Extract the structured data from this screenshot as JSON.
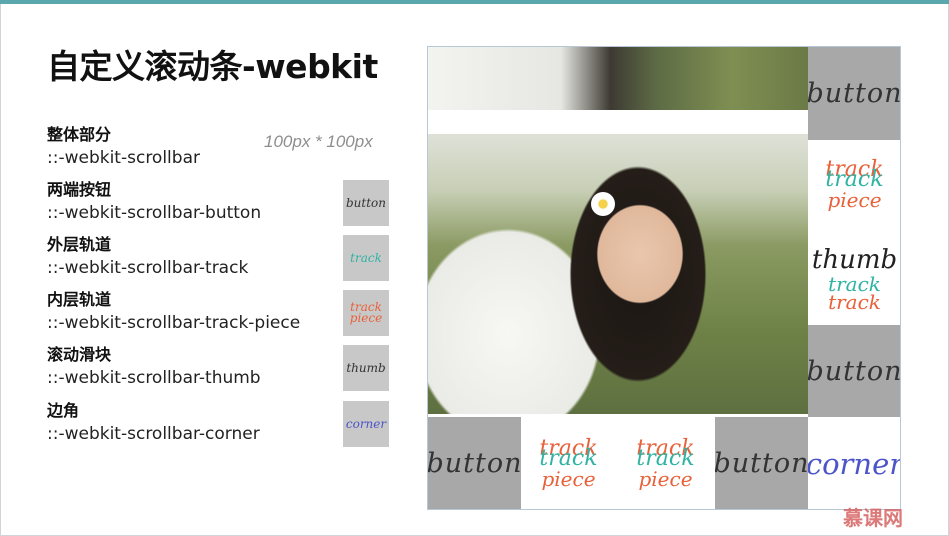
{
  "title": "自定义滚动条-webkit",
  "size_note": "100px * 100px",
  "items": [
    {
      "zh": "整体部分",
      "selector": "::-webkit-scrollbar"
    },
    {
      "zh": "两端按钮",
      "selector": "::-webkit-scrollbar-button",
      "swatch": "button",
      "swatch_color": "#333333"
    },
    {
      "zh": "外层轨道",
      "selector": "::-webkit-scrollbar-track",
      "swatch": "track",
      "swatch_color": "#2fb3a3"
    },
    {
      "zh": "内层轨道",
      "selector": "::-webkit-scrollbar-track-piece",
      "swatch": "track piece",
      "swatch_color": "#e8613a"
    },
    {
      "zh": "滚动滑块",
      "selector": "::-webkit-scrollbar-thumb",
      "swatch": "thumb",
      "swatch_color": "#333333"
    },
    {
      "zh": "边角",
      "selector": "::-webkit-scrollbar-corner",
      "swatch": "corner",
      "swatch_color": "#4b54c9"
    }
  ],
  "demo": {
    "button_label": "button",
    "track_label": "track",
    "piece_label": "piece",
    "thumb_label": "thumb",
    "corner_label": "corner"
  },
  "logo": "慕课网",
  "colors": {
    "accent": "#5aa7ae",
    "button_gray": "#a8a8a8",
    "swatch_gray": "#c8c8c8"
  }
}
